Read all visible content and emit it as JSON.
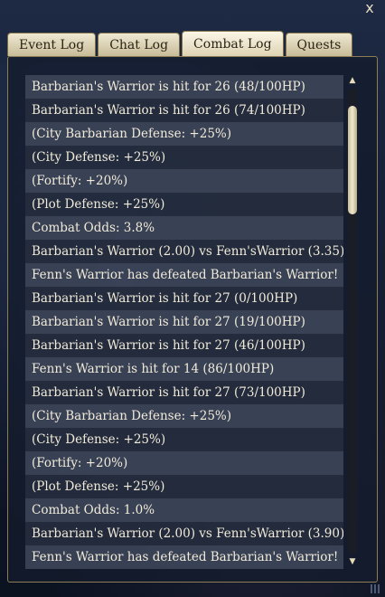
{
  "window": {
    "close_label": "x"
  },
  "tabs": [
    {
      "label": "Event Log",
      "active": false
    },
    {
      "label": "Chat Log",
      "active": false
    },
    {
      "label": "Combat Log",
      "active": true
    },
    {
      "label": "Quests",
      "active": false
    }
  ],
  "log": {
    "entries": [
      "Barbarian's Warrior is hit for 26 (48/100HP)",
      "Barbarian's Warrior is hit for 26 (74/100HP)",
      "(City Barbarian Defense: +25%)",
      "(City Defense: +25%)",
      "(Fortify: +20%)",
      "(Plot Defense: +25%)",
      "Combat Odds: 3.8%",
      "Barbarian's Warrior (2.00) vs Fenn'sWarrior (3.35)",
      "Fenn's Warrior has defeated Barbarian's Warrior!",
      "Barbarian's Warrior is hit for 27 (0/100HP)",
      "Barbarian's Warrior is hit for 27 (19/100HP)",
      "Barbarian's Warrior is hit for 27 (46/100HP)",
      "Fenn's Warrior is hit for 14 (86/100HP)",
      "Barbarian's Warrior is hit for 27 (73/100HP)",
      "(City Barbarian Defense: +25%)",
      "(City Defense: +25%)",
      "(Fortify: +20%)",
      "(Plot Defense: +25%)",
      "Combat Odds: 1.0%",
      "Barbarian's Warrior (2.00) vs Fenn'sWarrior (3.90)",
      "Fenn's Warrior has defeated Barbarian's Warrior!"
    ]
  },
  "scrollbar": {
    "up_icon": "triangle-up-icon",
    "down_icon": "triangle-down-icon"
  }
}
